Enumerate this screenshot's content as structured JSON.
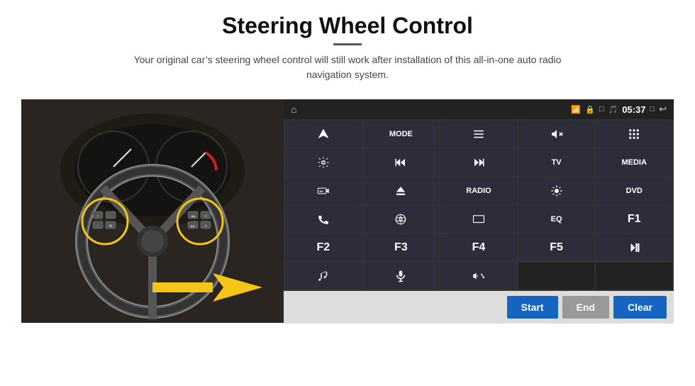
{
  "header": {
    "title": "Steering Wheel Control",
    "subtitle": "Your original car’s steering wheel control will still work after installation of this all-in-one auto radio navigation system."
  },
  "status_bar": {
    "time": "05:37",
    "home_icon": "⌂",
    "wifi_icon": "wifi",
    "bluetooth_icon": "bt",
    "lock_icon": "lock",
    "sd_icon": "sd",
    "back_icon": "↩",
    "menu_icon": "⋮⋮⋮"
  },
  "buttons": [
    {
      "id": "nav",
      "icon": "arrow_send",
      "text": "",
      "row": 1,
      "col": 1
    },
    {
      "id": "mode",
      "icon": "",
      "text": "MODE",
      "row": 1,
      "col": 2
    },
    {
      "id": "list",
      "icon": "list",
      "text": "",
      "row": 1,
      "col": 3
    },
    {
      "id": "mute",
      "icon": "mute",
      "text": "",
      "row": 1,
      "col": 4
    },
    {
      "id": "apps",
      "icon": "apps",
      "text": "",
      "row": 1,
      "col": 5
    },
    {
      "id": "settings",
      "icon": "settings",
      "text": "",
      "row": 2,
      "col": 1
    },
    {
      "id": "prev",
      "icon": "prev",
      "text": "",
      "row": 2,
      "col": 2
    },
    {
      "id": "next",
      "icon": "next",
      "text": "",
      "row": 2,
      "col": 3
    },
    {
      "id": "tv",
      "icon": "",
      "text": "TV",
      "row": 2,
      "col": 4
    },
    {
      "id": "media",
      "icon": "",
      "text": "MEDIA",
      "row": 2,
      "col": 5
    },
    {
      "id": "cam360",
      "icon": "cam360",
      "text": "",
      "row": 3,
      "col": 1
    },
    {
      "id": "eject",
      "icon": "eject",
      "text": "",
      "row": 3,
      "col": 2
    },
    {
      "id": "radio",
      "icon": "",
      "text": "RADIO",
      "row": 3,
      "col": 3
    },
    {
      "id": "brightness",
      "icon": "sun",
      "text": "",
      "row": 3,
      "col": 4
    },
    {
      "id": "dvd",
      "icon": "",
      "text": "DVD",
      "row": 3,
      "col": 5
    },
    {
      "id": "phone",
      "icon": "phone",
      "text": "",
      "row": 4,
      "col": 1
    },
    {
      "id": "gps",
      "icon": "gps",
      "text": "",
      "row": 4,
      "col": 2
    },
    {
      "id": "screen",
      "icon": "screen",
      "text": "",
      "row": 4,
      "col": 3
    },
    {
      "id": "eq",
      "icon": "",
      "text": "EQ",
      "row": 4,
      "col": 4
    },
    {
      "id": "f1",
      "icon": "",
      "text": "F1",
      "row": 4,
      "col": 5
    },
    {
      "id": "f2",
      "icon": "",
      "text": "F2",
      "row": 5,
      "col": 1
    },
    {
      "id": "f3",
      "icon": "",
      "text": "F3",
      "row": 5,
      "col": 2
    },
    {
      "id": "f4",
      "icon": "",
      "text": "F4",
      "row": 5,
      "col": 3
    },
    {
      "id": "f5",
      "icon": "",
      "text": "F5",
      "row": 5,
      "col": 4
    },
    {
      "id": "playpause",
      "icon": "playpause",
      "text": "",
      "row": 5,
      "col": 5
    },
    {
      "id": "music",
      "icon": "music",
      "text": "",
      "row": 6,
      "col": 1
    },
    {
      "id": "mic",
      "icon": "mic",
      "text": "",
      "row": 6,
      "col": 2
    },
    {
      "id": "vol_phone",
      "icon": "vol_phone",
      "text": "",
      "row": 6,
      "col": 3
    }
  ],
  "action_buttons": {
    "start": "Start",
    "end": "End",
    "clear": "Clear"
  }
}
